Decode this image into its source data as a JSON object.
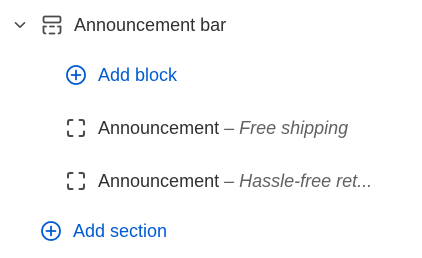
{
  "colors": {
    "text": "#303030",
    "secondary_text": "#616161",
    "link": "#005bd3",
    "icon": "#4a4a4a"
  },
  "tree": {
    "section": {
      "label": "Announcement bar",
      "chevron_icon": "chevron-down-icon",
      "section_icon": "section-layout-icon"
    },
    "add_block": {
      "label": "Add block",
      "icon": "plus-circle-icon"
    },
    "blocks": [
      {
        "title": "Announcement",
        "separator": "–",
        "subtitle": "Free shipping",
        "icon": "block-dashed-icon"
      },
      {
        "title": "Announcement",
        "separator": "–",
        "subtitle": "Hassle-free ret...",
        "icon": "block-dashed-icon"
      }
    ],
    "add_section": {
      "label": "Add section",
      "icon": "plus-circle-icon"
    }
  }
}
